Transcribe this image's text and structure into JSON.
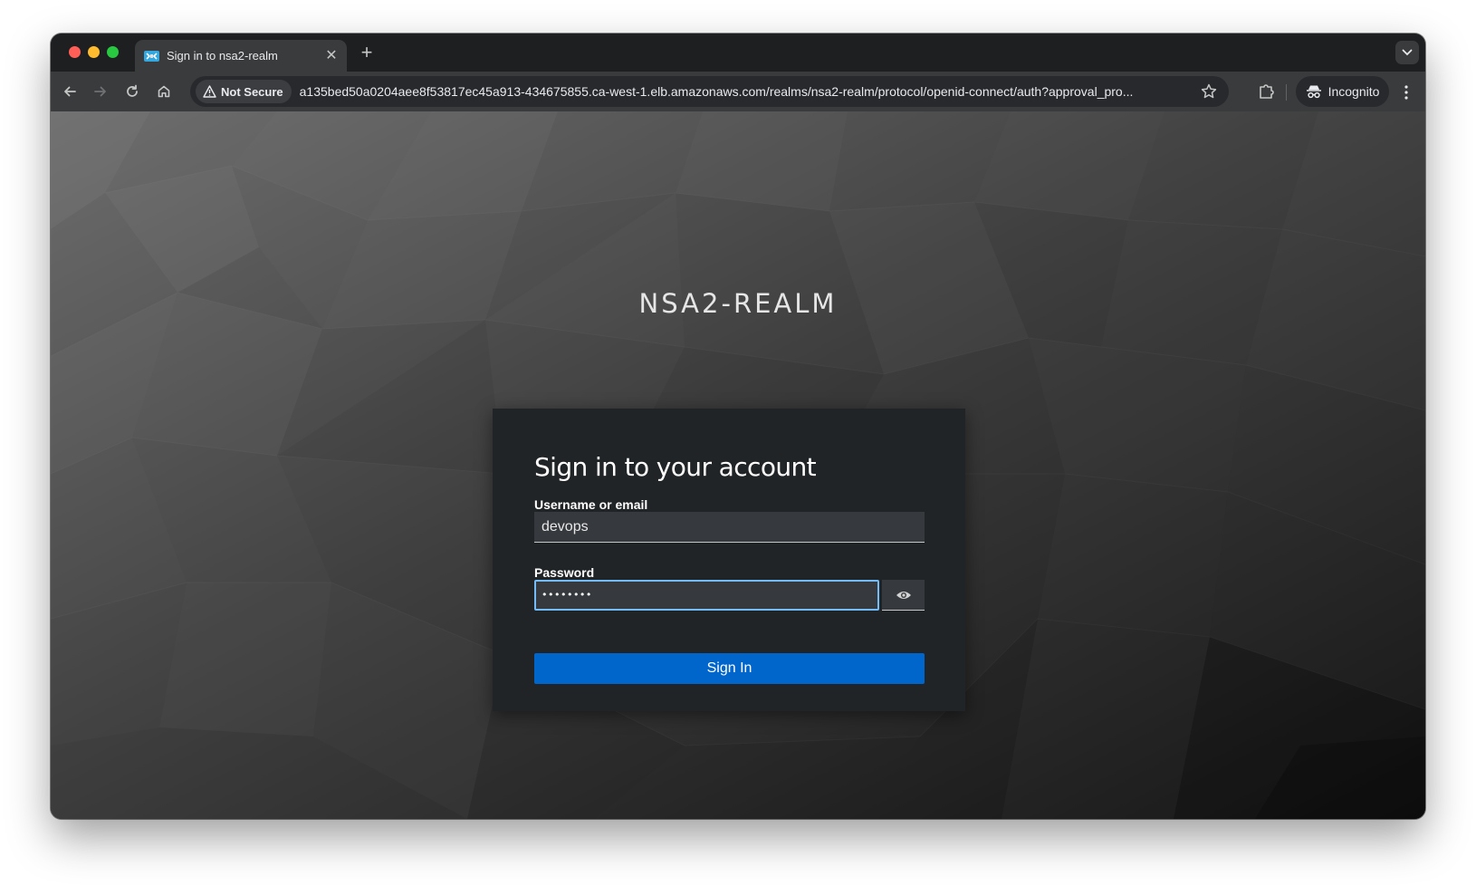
{
  "browser": {
    "tab": {
      "title": "Sign in to nsa2-realm",
      "close": "✕",
      "favicon": "keycloak-favicon-icon"
    },
    "new_tab": "+",
    "tab_menu": "⌄",
    "security_chip": {
      "label": "Not Secure",
      "icon": "warning-triangle-icon"
    },
    "url": "a135bed50a0204aee8f53817ec45a913-434675855.ca-west-1.elb.amazonaws.com/realms/nsa2-realm/protocol/openid-connect/auth?approval_pro...",
    "incognito_label": "Incognito"
  },
  "page": {
    "realm_name": "NSA2-REALM",
    "card_title": "Sign in to your account",
    "username_label": "Username or email",
    "username_value": "devops",
    "password_label": "Password",
    "password_value": "••••••••",
    "signin_label": "Sign In"
  },
  "colors": {
    "accent": "#0066cc",
    "focus": "#73bcf7",
    "card_bg": "#212427",
    "input_bg": "#36393d"
  }
}
